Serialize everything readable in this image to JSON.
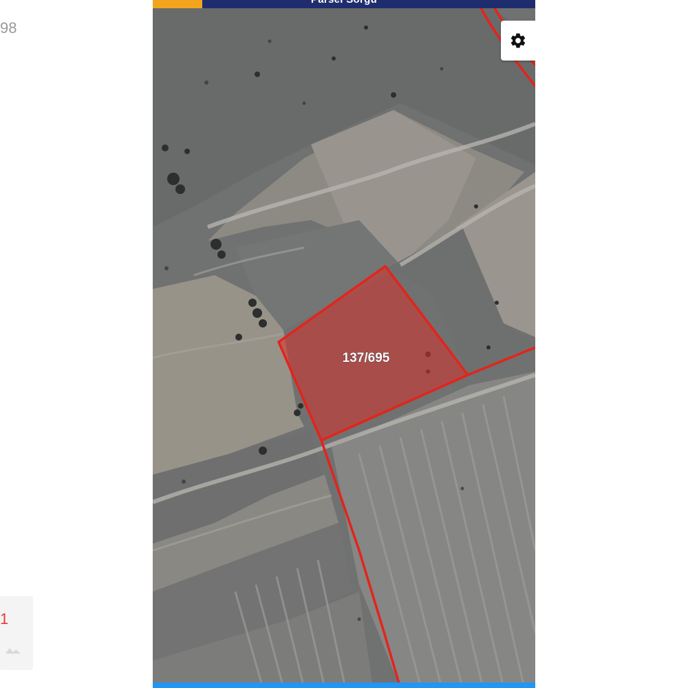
{
  "side_panel": {
    "partial_number": "98",
    "thumbnail_mark": "1"
  },
  "app_bar": {
    "title": "Parsel Sorgu",
    "accent_color": "#f2a51c",
    "bar_color": "#1f2d6e"
  },
  "controls": {
    "settings_icon": "gear-icon"
  },
  "map": {
    "type": "satellite",
    "parcel": {
      "label": "137/695",
      "fill_color": "#d9302a",
      "border_color": "#e3241b"
    },
    "boundary_color": "#e3241b"
  },
  "bottom_bar": {
    "color": "#2196f3"
  }
}
